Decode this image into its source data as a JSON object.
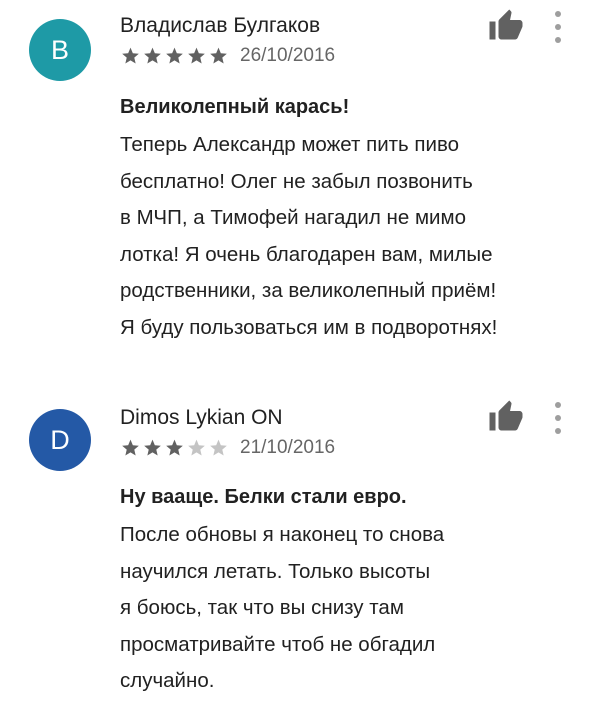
{
  "reviews": [
    {
      "avatar_letter": "B",
      "avatar_color": "#1e9aa6",
      "author": "Владислав Булгаков",
      "rating": 5,
      "date": "26/10/2016",
      "title": "Великолепный карась!",
      "text": "Теперь Александр может пить пиво\nбесплатно! Олег не забыл позвонить\nв МЧП, а Тимофей нагадил не мимо\nлотка! Я очень благодарен вам, милые\nродственники, за великолепный приём!\nЯ буду пользоваться им в подворотнях!",
      "icons": {
        "like": "thumb-up-icon",
        "more": "more-vert-icon"
      }
    },
    {
      "avatar_letter": "D",
      "avatar_color": "#2459a6",
      "author": "Dimos Lykian ON",
      "rating": 3,
      "date": "21/10/2016",
      "title": "Ну вааще. Белки стали евро.",
      "text": "После обновы я наконец то снова\nнаучился летать. Только высоты\nя боюсь, так что вы снизу там\nпросматривайте чтоб не обгадил\nслучайно.",
      "icons": {
        "like": "thumb-up-icon",
        "more": "more-vert-icon"
      }
    }
  ],
  "colors": {
    "star_filled": "#616161",
    "star_empty": "#c4c4c4"
  }
}
